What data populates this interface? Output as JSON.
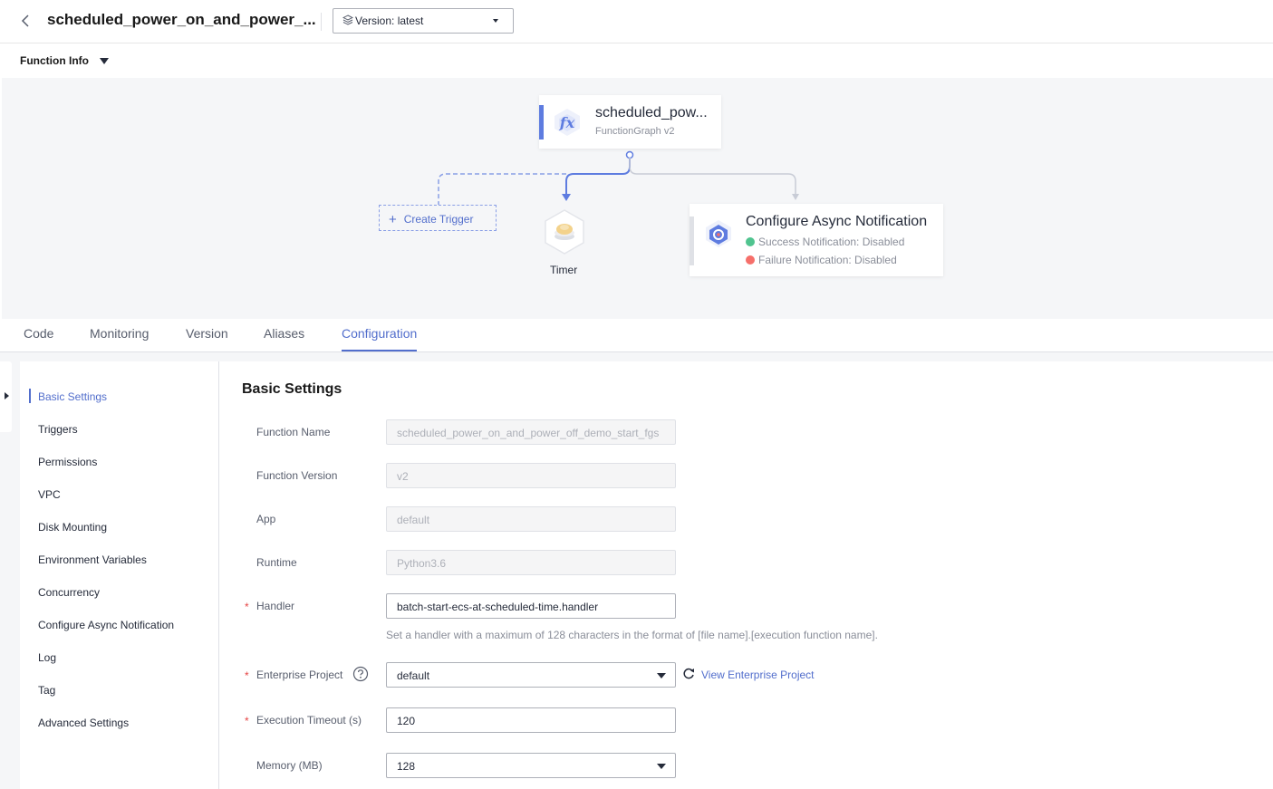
{
  "header": {
    "title": "scheduled_power_on_and_power_...",
    "version_label": "Version: latest"
  },
  "function_info": {
    "label": "Function Info"
  },
  "diagram": {
    "function_card": {
      "name": "scheduled_pow...",
      "subtitle": "FunctionGraph v2"
    },
    "create_trigger_label": "Create Trigger",
    "timer_label": "Timer",
    "async_card": {
      "title": "Configure Async Notification",
      "success_text": "Success Notification: Disabled",
      "failure_text": "Failure Notification: Disabled",
      "success_color": "#50c48f",
      "failure_color": "#f66f6a"
    }
  },
  "tabs": [
    {
      "label": "Code"
    },
    {
      "label": "Monitoring"
    },
    {
      "label": "Version"
    },
    {
      "label": "Aliases"
    },
    {
      "label": "Configuration",
      "active": true
    }
  ],
  "side_nav": {
    "items": [
      {
        "label": "Basic Settings",
        "active": true
      },
      {
        "label": "Triggers"
      },
      {
        "label": "Permissions"
      },
      {
        "label": "VPC"
      },
      {
        "label": "Disk Mounting"
      },
      {
        "label": "Environment Variables"
      },
      {
        "label": "Concurrency"
      },
      {
        "label": "Configure Async Notification"
      },
      {
        "label": "Log"
      },
      {
        "label": "Tag"
      },
      {
        "label": "Advanced Settings"
      }
    ]
  },
  "basic_settings": {
    "title": "Basic Settings",
    "required_mark": "*",
    "fields": {
      "function_name": {
        "label": "Function Name",
        "value": "scheduled_power_on_and_power_off_demo_start_fgs"
      },
      "function_version": {
        "label": "Function Version",
        "value": "v2"
      },
      "app": {
        "label": "App",
        "value": "default"
      },
      "runtime": {
        "label": "Runtime",
        "value": "Python3.6"
      },
      "handler": {
        "label": "Handler",
        "value": "batch-start-ecs-at-scheduled-time.handler",
        "hint": "Set a handler with a maximum of 128 characters in the format of [file name].[execution function name]."
      },
      "enterprise_project": {
        "label": "Enterprise Project",
        "value": "default",
        "link": "View Enterprise Project"
      },
      "execution_timeout": {
        "label": "Execution Timeout (s)",
        "value": "120"
      },
      "memory": {
        "label": "Memory (MB)",
        "value": "128"
      }
    }
  },
  "colors": {
    "accent": "#526ecc",
    "required": "#e54545"
  }
}
